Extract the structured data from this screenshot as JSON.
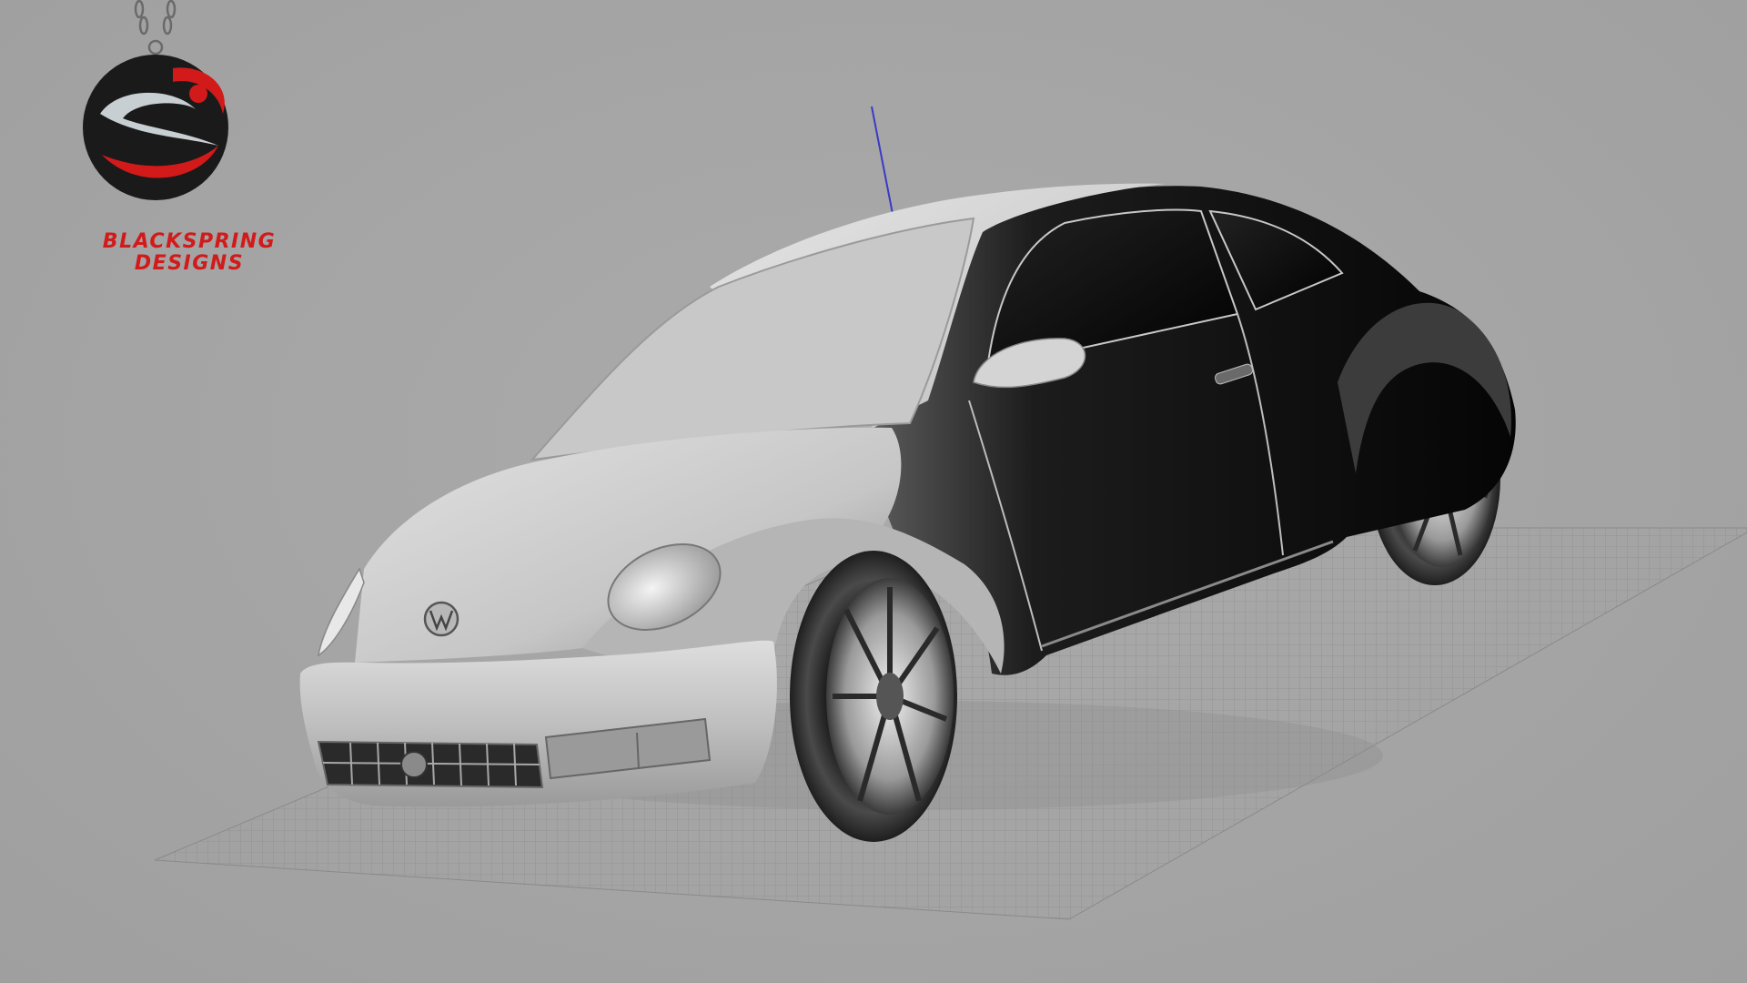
{
  "viewport": {
    "background_color": "#a6a6a6",
    "view_type": "3D shaded perspective viewport",
    "model": "Volkswagen Beetle",
    "ground_grid": true,
    "axis_indicator_color": "#3a3ac8"
  },
  "logo": {
    "line1": "BLACKSPRING",
    "line2": "DESIGNS",
    "accent_color": "#d21a1a",
    "dark_color": "#1a1a1a",
    "icon": "blackspring-pendant-icon"
  },
  "car": {
    "badge": "vw-badge-icon",
    "body_light_color": "#d6d6d6",
    "body_dark_color": "#111111"
  }
}
